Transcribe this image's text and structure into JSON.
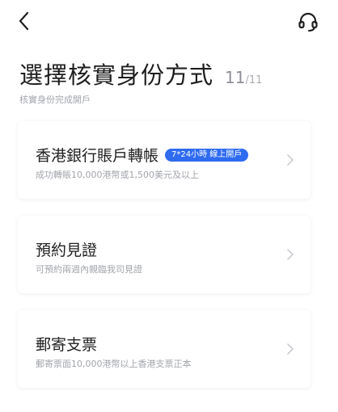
{
  "header": {
    "back_icon": "chevron-left-icon",
    "support_icon": "headset-icon"
  },
  "page": {
    "title": "選擇核實身份方式",
    "step_current": "11",
    "step_separator": "/",
    "step_total": "11",
    "subtitle": "核實身份完成開戶"
  },
  "options": [
    {
      "title": "香港銀行賬戶轉帳",
      "badge": "7*24小時 線上開戶",
      "description": "成功轉賬10,000港幣或1,500美元及以上"
    },
    {
      "title": "預約見證",
      "description": "可預約兩週內親臨我司見證"
    },
    {
      "title": "郵寄支票",
      "description": "郵寄票面10,000港幣以上香港支票正本"
    }
  ],
  "colors": {
    "accent": "#2f6bf0",
    "title_text": "#1e1e1e",
    "muted_text": "#a3a5ab"
  }
}
